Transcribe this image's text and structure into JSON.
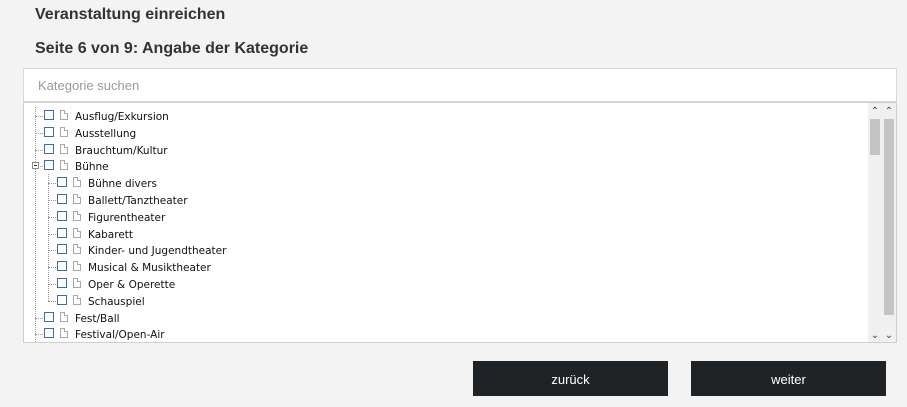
{
  "header": {
    "title": "Veranstaltung einreichen",
    "step": "Seite 6 von 9: Angabe der Kategorie"
  },
  "search": {
    "placeholder": "Kategorie suchen",
    "value": ""
  },
  "tree": {
    "items": [
      {
        "label": "Ausflug/Exkursion",
        "level": 0,
        "expanded": false,
        "checked": false
      },
      {
        "label": "Ausstellung",
        "level": 0,
        "expanded": false,
        "checked": false
      },
      {
        "label": "Brauchtum/Kultur",
        "level": 0,
        "expanded": false,
        "checked": false
      },
      {
        "label": "Bühne",
        "level": 0,
        "expanded": true,
        "checked": false
      },
      {
        "label": "Bühne divers",
        "level": 1,
        "checked": false
      },
      {
        "label": "Ballett/Tanztheater",
        "level": 1,
        "checked": false
      },
      {
        "label": "Figurentheater",
        "level": 1,
        "checked": false
      },
      {
        "label": "Kabarett",
        "level": 1,
        "checked": false
      },
      {
        "label": "Kinder- und Jugendtheater",
        "level": 1,
        "checked": false
      },
      {
        "label": "Musical & Musiktheater",
        "level": 1,
        "checked": false
      },
      {
        "label": "Oper & Operette",
        "level": 1,
        "checked": false
      },
      {
        "label": "Schauspiel",
        "level": 1,
        "checked": false
      },
      {
        "label": "Fest/Ball",
        "level": 0,
        "expanded": false,
        "checked": false
      },
      {
        "label": "Festival/Open-Air",
        "level": 0,
        "expanded": false,
        "checked": false
      }
    ]
  },
  "scrollbar": {
    "up_icon": "chevron-up",
    "down_icon": "chevron-down"
  },
  "buttons": {
    "back_label": "zurück",
    "next_label": "weiter"
  },
  "colors": {
    "button_bg": "#1f2326",
    "checkbox_border": "#3a6ea5",
    "page_bg": "#f3f3f3"
  }
}
